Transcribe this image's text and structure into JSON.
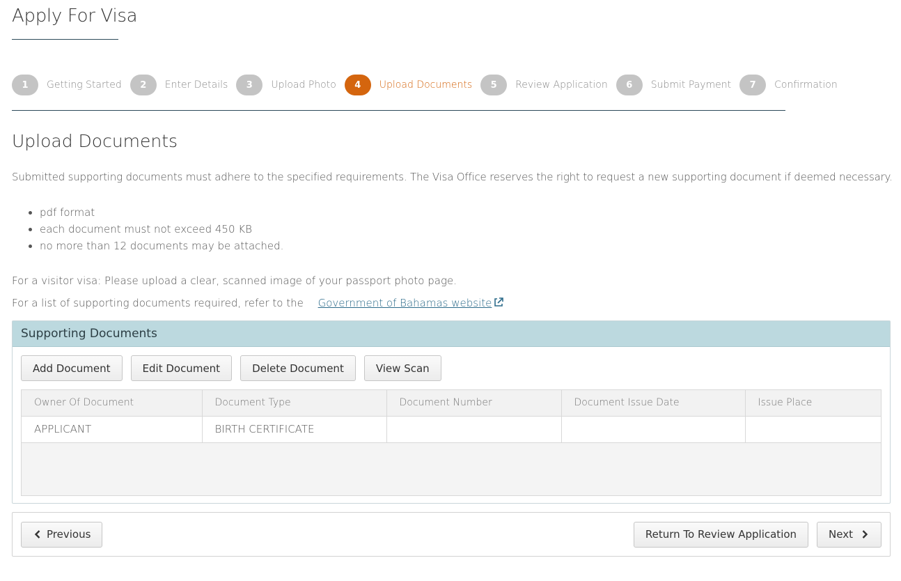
{
  "page": {
    "title": "Apply For Visa"
  },
  "stepper": {
    "steps": [
      {
        "number": "1",
        "label": "Getting Started"
      },
      {
        "number": "2",
        "label": "Enter Details"
      },
      {
        "number": "3",
        "label": "Upload Photo"
      },
      {
        "number": "4",
        "label": "Upload Documents"
      },
      {
        "number": "5",
        "label": "Review Application"
      },
      {
        "number": "6",
        "label": "Submit Payment"
      },
      {
        "number": "7",
        "label": "Confirmation"
      }
    ],
    "active_step": "4",
    "colors": {
      "active": "#d4650e",
      "inactive": "#c4c4c4"
    }
  },
  "section": {
    "title": "Upload Documents",
    "intro": "Submitted supporting documents must adhere to the specified requirements. The Visa Office reserves the right to request a new supporting document if deemed necessary.",
    "requirements": [
      "pdf format",
      "each document must not exceed 450 KB",
      "no more than 12 documents may be attached."
    ],
    "visitor_note": "For a visitor visa: Please upload a clear, scanned image of your passport photo page.",
    "list_note": "For a list of supporting documents required, refer to the",
    "link_text": "Government of Bahamas website",
    "link_icon": "external-link-icon"
  },
  "panel": {
    "heading": "Supporting Documents",
    "buttons": {
      "add": "Add Document",
      "edit": "Edit Document",
      "delete": "Delete Document",
      "view": "View Scan"
    },
    "table": {
      "columns": [
        "Owner Of Document",
        "Document Type",
        "Document Number",
        "Document Issue Date",
        "Issue Place"
      ],
      "rows": [
        [
          "APPLICANT",
          "BIRTH CERTIFICATE",
          "",
          "",
          ""
        ]
      ]
    },
    "heading_color": "#bcd9df"
  },
  "navigation": {
    "previous": "Previous",
    "return_review": "Return To Review Application",
    "next": "Next",
    "previous_icon": "chevron-left-icon",
    "next_icon": "chevron-right-icon"
  }
}
